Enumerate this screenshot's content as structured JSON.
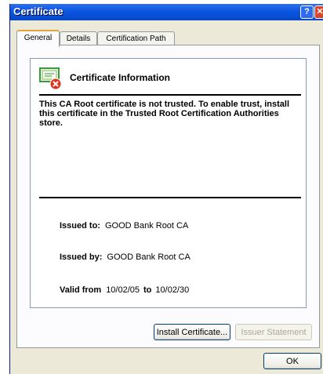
{
  "window": {
    "title": "Certificate"
  },
  "titlebar": {
    "help_glyph": "?",
    "close_glyph": "✕"
  },
  "tabs": [
    {
      "label": "General",
      "active": true
    },
    {
      "label": "Details",
      "active": false
    },
    {
      "label": "Certification Path",
      "active": false
    }
  ],
  "info": {
    "heading": "Certificate Information",
    "icon": "certificate-error-icon",
    "message": "This CA Root certificate is not trusted. To enable trust, install this certificate in the Trusted Root Certification Authorities store."
  },
  "fields": {
    "issued_to_label": "Issued to:",
    "issued_to_value": "GOOD Bank Root CA",
    "issued_by_label": "Issued by:",
    "issued_by_value": "GOOD Bank Root CA",
    "valid_from_label": "Valid from",
    "valid_from_value": "10/02/05",
    "valid_to_word": "to",
    "valid_to_value": "10/02/30"
  },
  "buttons": {
    "install": "Install Certificate...",
    "issuer": "Issuer Statement",
    "ok": "OK"
  },
  "colors": {
    "titlebar": "#0a56e0",
    "error_badge": "#e0301e",
    "cert_green": "#3c9a3c"
  }
}
